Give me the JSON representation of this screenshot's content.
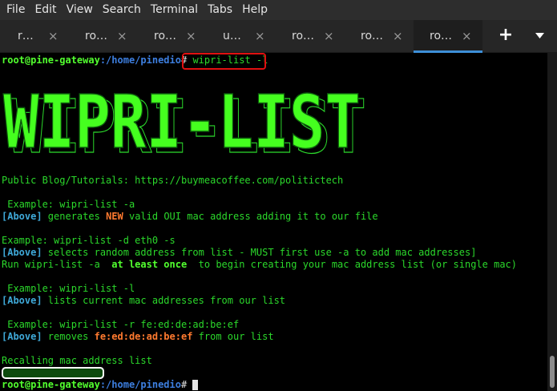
{
  "menu": [
    "File",
    "Edit",
    "View",
    "Search",
    "Terminal",
    "Tabs",
    "Help"
  ],
  "tabs": [
    {
      "label": "r…",
      "close": "×"
    },
    {
      "label": "ro…",
      "close": "×"
    },
    {
      "label": "ro…",
      "close": "×"
    },
    {
      "label": "u…",
      "close": "×"
    },
    {
      "label": "ro…",
      "close": "×"
    },
    {
      "label": "ro…",
      "close": "×"
    },
    {
      "label": "ro…",
      "close": "×"
    }
  ],
  "new_tab_glyph": "+",
  "terminal": {
    "prompt_user": "root@pine-gateway",
    "prompt_path": ":/home/pinedio",
    "prompt_symbol": "# ",
    "command": "wipri-list -l",
    "banner_text": "WIPRI-LIST",
    "blog_line": "Public Blog/Tutorials: https://buymeacoffee.com/politictech",
    "ex1_label": " Example: ",
    "ex1_cmd": "wipri-list -a",
    "above": "[Above]",
    "ex1_desc_a": " generates ",
    "ex1_desc_new": "NEW",
    "ex1_desc_b": " valid OUI mac address adding it to our file",
    "ex2_label": "Example: ",
    "ex2_cmd": "wipri-list -d eth0 -s",
    "ex2_desc": " selects random address from list - MUST first use -a to add mac addresses]",
    "ex2_run_a": "Run wipri-list -a  ",
    "ex2_run_bold": "at least once",
    "ex2_run_b": "  to begin creating your mac address list (or single mac)",
    "ex3_label": " Example: ",
    "ex3_cmd": "wipri-list -l",
    "ex3_desc": " lists current mac addresses from our list",
    "ex4_label": " Example: ",
    "ex4_cmd": "wipri-list -r fe:ed:de:ad:be:ef",
    "ex4_desc_a": " removes ",
    "ex4_desc_mac": "fe:ed:de:ad:be:ef",
    "ex4_desc_b": " from our list",
    "recalling": "Recalling mac address list"
  },
  "colors": {
    "green": "#2bd82b",
    "blue_user": "#3d7fe0",
    "cyan_above": "#3fa9d8",
    "orange": "#ff7a2f",
    "highlight_box": "#e01010",
    "tab_accent": "#3d8fd8"
  }
}
